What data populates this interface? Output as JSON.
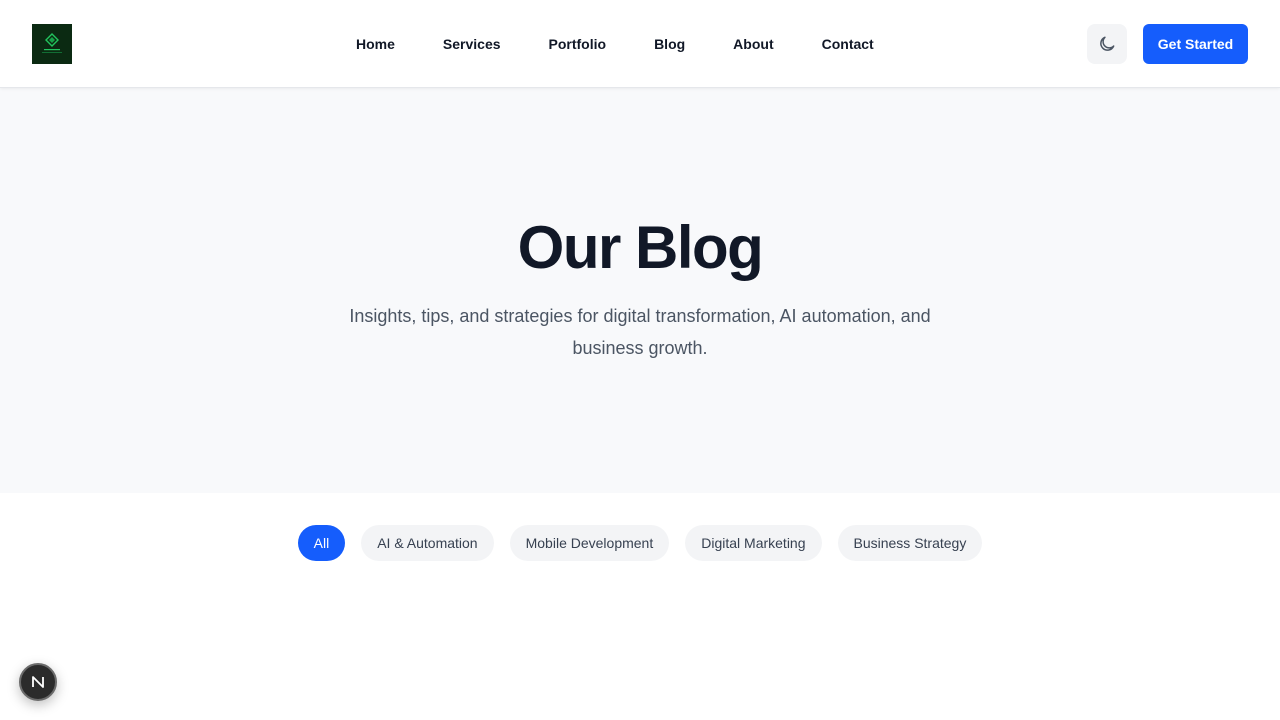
{
  "header": {
    "logo_icon": "leaf-logo-icon",
    "nav": [
      {
        "label": "Home"
      },
      {
        "label": "Services"
      },
      {
        "label": "Portfolio"
      },
      {
        "label": "Blog"
      },
      {
        "label": "About"
      },
      {
        "label": "Contact"
      }
    ],
    "theme_toggle_icon": "moon-icon",
    "cta_label": "Get Started"
  },
  "hero": {
    "title": "Our Blog",
    "subtitle": "Insights, tips, and strategies for digital transformation, AI automation, and business growth."
  },
  "filters": {
    "items": [
      {
        "label": "All",
        "active": true
      },
      {
        "label": "AI & Automation",
        "active": false
      },
      {
        "label": "Mobile Development",
        "active": false
      },
      {
        "label": "Digital Marketing",
        "active": false
      },
      {
        "label": "Business Strategy",
        "active": false
      }
    ]
  },
  "dev_badge": {
    "icon": "nextjs-logo-icon"
  },
  "colors": {
    "accent": "#155dfc",
    "hero_bg": "#f8f9fb",
    "pill_bg": "#f3f4f6",
    "text_dark": "#111827",
    "text_muted": "#4b5563"
  }
}
